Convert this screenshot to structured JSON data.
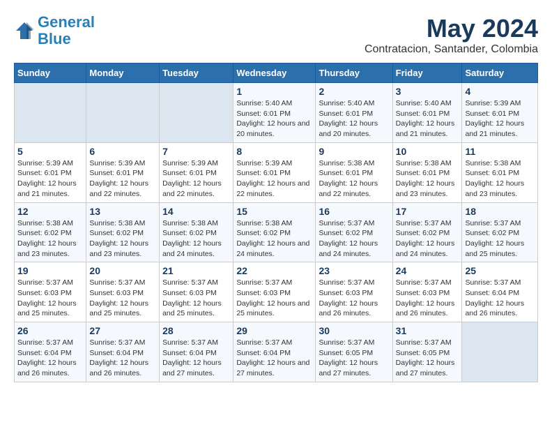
{
  "header": {
    "logo_line1": "General",
    "logo_line2": "Blue",
    "title": "May 2024",
    "subtitle": "Contratacion, Santander, Colombia"
  },
  "days_of_week": [
    "Sunday",
    "Monday",
    "Tuesday",
    "Wednesday",
    "Thursday",
    "Friday",
    "Saturday"
  ],
  "weeks": [
    [
      {
        "day": "",
        "info": ""
      },
      {
        "day": "",
        "info": ""
      },
      {
        "day": "",
        "info": ""
      },
      {
        "day": "1",
        "info": "Sunrise: 5:40 AM\nSunset: 6:01 PM\nDaylight: 12 hours and 20 minutes."
      },
      {
        "day": "2",
        "info": "Sunrise: 5:40 AM\nSunset: 6:01 PM\nDaylight: 12 hours and 20 minutes."
      },
      {
        "day": "3",
        "info": "Sunrise: 5:40 AM\nSunset: 6:01 PM\nDaylight: 12 hours and 21 minutes."
      },
      {
        "day": "4",
        "info": "Sunrise: 5:39 AM\nSunset: 6:01 PM\nDaylight: 12 hours and 21 minutes."
      }
    ],
    [
      {
        "day": "5",
        "info": "Sunrise: 5:39 AM\nSunset: 6:01 PM\nDaylight: 12 hours and 21 minutes."
      },
      {
        "day": "6",
        "info": "Sunrise: 5:39 AM\nSunset: 6:01 PM\nDaylight: 12 hours and 22 minutes."
      },
      {
        "day": "7",
        "info": "Sunrise: 5:39 AM\nSunset: 6:01 PM\nDaylight: 12 hours and 22 minutes."
      },
      {
        "day": "8",
        "info": "Sunrise: 5:39 AM\nSunset: 6:01 PM\nDaylight: 12 hours and 22 minutes."
      },
      {
        "day": "9",
        "info": "Sunrise: 5:38 AM\nSunset: 6:01 PM\nDaylight: 12 hours and 22 minutes."
      },
      {
        "day": "10",
        "info": "Sunrise: 5:38 AM\nSunset: 6:01 PM\nDaylight: 12 hours and 23 minutes."
      },
      {
        "day": "11",
        "info": "Sunrise: 5:38 AM\nSunset: 6:01 PM\nDaylight: 12 hours and 23 minutes."
      }
    ],
    [
      {
        "day": "12",
        "info": "Sunrise: 5:38 AM\nSunset: 6:02 PM\nDaylight: 12 hours and 23 minutes."
      },
      {
        "day": "13",
        "info": "Sunrise: 5:38 AM\nSunset: 6:02 PM\nDaylight: 12 hours and 23 minutes."
      },
      {
        "day": "14",
        "info": "Sunrise: 5:38 AM\nSunset: 6:02 PM\nDaylight: 12 hours and 24 minutes."
      },
      {
        "day": "15",
        "info": "Sunrise: 5:38 AM\nSunset: 6:02 PM\nDaylight: 12 hours and 24 minutes."
      },
      {
        "day": "16",
        "info": "Sunrise: 5:37 AM\nSunset: 6:02 PM\nDaylight: 12 hours and 24 minutes."
      },
      {
        "day": "17",
        "info": "Sunrise: 5:37 AM\nSunset: 6:02 PM\nDaylight: 12 hours and 24 minutes."
      },
      {
        "day": "18",
        "info": "Sunrise: 5:37 AM\nSunset: 6:02 PM\nDaylight: 12 hours and 25 minutes."
      }
    ],
    [
      {
        "day": "19",
        "info": "Sunrise: 5:37 AM\nSunset: 6:03 PM\nDaylight: 12 hours and 25 minutes."
      },
      {
        "day": "20",
        "info": "Sunrise: 5:37 AM\nSunset: 6:03 PM\nDaylight: 12 hours and 25 minutes."
      },
      {
        "day": "21",
        "info": "Sunrise: 5:37 AM\nSunset: 6:03 PM\nDaylight: 12 hours and 25 minutes."
      },
      {
        "day": "22",
        "info": "Sunrise: 5:37 AM\nSunset: 6:03 PM\nDaylight: 12 hours and 25 minutes."
      },
      {
        "day": "23",
        "info": "Sunrise: 5:37 AM\nSunset: 6:03 PM\nDaylight: 12 hours and 26 minutes."
      },
      {
        "day": "24",
        "info": "Sunrise: 5:37 AM\nSunset: 6:03 PM\nDaylight: 12 hours and 26 minutes."
      },
      {
        "day": "25",
        "info": "Sunrise: 5:37 AM\nSunset: 6:04 PM\nDaylight: 12 hours and 26 minutes."
      }
    ],
    [
      {
        "day": "26",
        "info": "Sunrise: 5:37 AM\nSunset: 6:04 PM\nDaylight: 12 hours and 26 minutes."
      },
      {
        "day": "27",
        "info": "Sunrise: 5:37 AM\nSunset: 6:04 PM\nDaylight: 12 hours and 26 minutes."
      },
      {
        "day": "28",
        "info": "Sunrise: 5:37 AM\nSunset: 6:04 PM\nDaylight: 12 hours and 27 minutes."
      },
      {
        "day": "29",
        "info": "Sunrise: 5:37 AM\nSunset: 6:04 PM\nDaylight: 12 hours and 27 minutes."
      },
      {
        "day": "30",
        "info": "Sunrise: 5:37 AM\nSunset: 6:05 PM\nDaylight: 12 hours and 27 minutes."
      },
      {
        "day": "31",
        "info": "Sunrise: 5:37 AM\nSunset: 6:05 PM\nDaylight: 12 hours and 27 minutes."
      },
      {
        "day": "",
        "info": ""
      }
    ]
  ]
}
